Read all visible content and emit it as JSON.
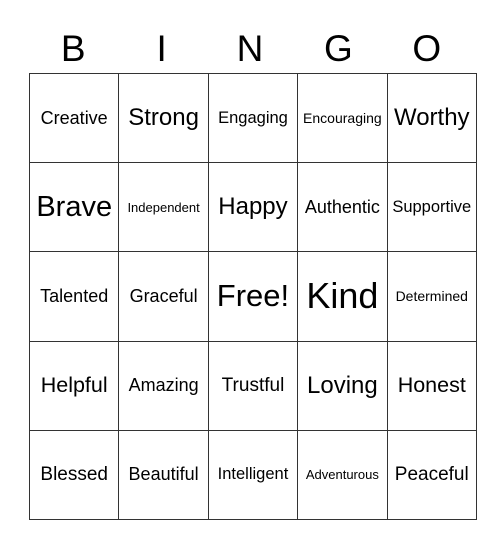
{
  "header": [
    "B",
    "I",
    "N",
    "G",
    "O"
  ],
  "rows": [
    [
      "Creative",
      "Strong",
      "Engaging",
      "Encouraging",
      "Worthy"
    ],
    [
      "Brave",
      "Independent",
      "Happy",
      "Authentic",
      "Supportive"
    ],
    [
      "Talented",
      "Graceful",
      "Free!",
      "Kind",
      "Determined"
    ],
    [
      "Helpful",
      "Amazing",
      "Trustful",
      "Loving",
      "Honest"
    ],
    [
      "Blessed",
      "Beautiful",
      "Intelligent",
      "Adventurous",
      "Peaceful"
    ]
  ]
}
